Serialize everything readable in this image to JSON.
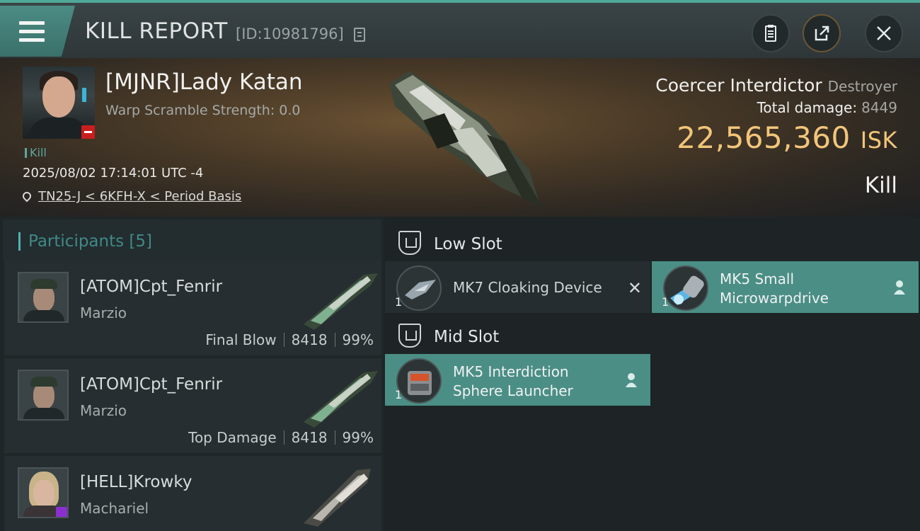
{
  "header": {
    "title": "KILL REPORT",
    "report_id": "[ID:10981796]"
  },
  "victim": {
    "name": "[MJNR]Lady Katan",
    "warp_scramble": "Warp Scramble Strength: 0.0",
    "tag": "Kill",
    "datetime": "2025/08/02 17:14:01 UTC -4",
    "location": "TN25-J < 6KFH-X < Period Basis",
    "ship": "Coercer Interdictor",
    "ship_class": "Destroyer",
    "total_damage_label": "Total damage:",
    "total_damage": "8449",
    "isk_value": "22,565,360",
    "isk_unit": "ISK",
    "result": "Kill"
  },
  "participants": {
    "label": "Participants [5]",
    "items": [
      {
        "name": "[ATOM]Cpt_Fenrir",
        "ship": "Marzio",
        "role": "Final Blow",
        "damage": "8418",
        "percent": "99%"
      },
      {
        "name": "[ATOM]Cpt_Fenrir",
        "ship": "Marzio",
        "role": "Top Damage",
        "damage": "8418",
        "percent": "99%"
      },
      {
        "name": "[HELL]Krowky",
        "ship": "Machariel"
      }
    ]
  },
  "fitting": {
    "low_slot_label": "Low Slot",
    "mid_slot_label": "Mid Slot",
    "low": [
      {
        "qty": "1",
        "name": "MK7 Cloaking Device",
        "state": "destroyed"
      },
      {
        "qty": "1",
        "name_line1": "MK5 Small",
        "name_line2": "Microwarpdrive",
        "state": "dropped"
      }
    ],
    "mid": [
      {
        "qty": "1",
        "name_line1": "MK5 Interdiction",
        "name_line2": "Sphere Launcher",
        "state": "dropped"
      }
    ]
  },
  "colors": {
    "accent_teal": "#4b8e85",
    "isk_gold": "#f2c57a",
    "badge_red": "#c91e1e"
  },
  "icons": [
    "menu-icon",
    "copy-icon",
    "clipboard-icon",
    "share-icon",
    "close-icon",
    "location-pin-icon",
    "shield-slot-icon",
    "user-icon",
    "x-icon"
  ]
}
